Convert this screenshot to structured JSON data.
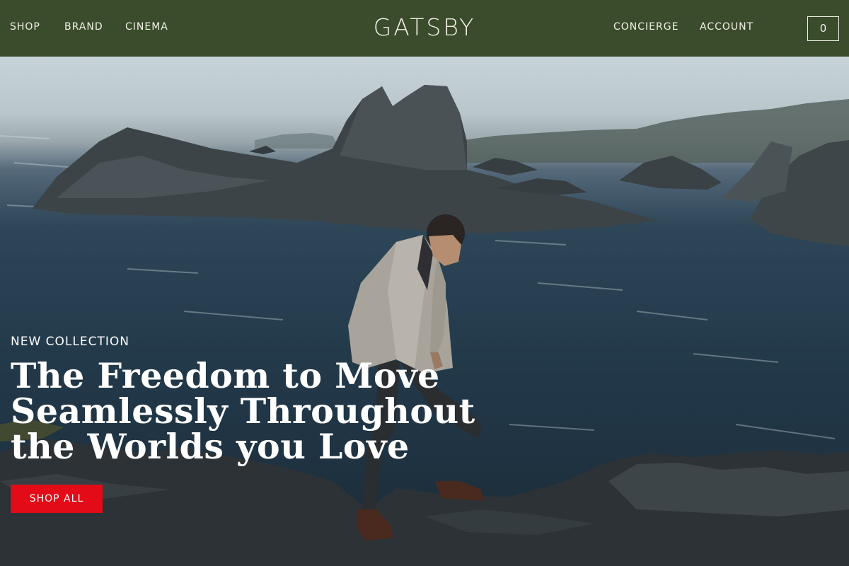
{
  "header": {
    "nav_left": [
      "SHOP",
      "BRAND",
      "CINEMA"
    ],
    "logo": "GATSBY",
    "nav_right": [
      "CONCIERGE",
      "ACCOUNT"
    ],
    "cart_count": "0"
  },
  "hero": {
    "eyebrow": "NEW COLLECTION",
    "headline_lines": [
      "The Freedom to Move",
      "Seamlessly Throughout",
      "the Worlds you Love"
    ],
    "cta_label": "SHOP ALL"
  },
  "colors": {
    "header_bg": "#3a4c2c",
    "header_text": "#f2f0e6",
    "cta_bg": "#e30b17",
    "hero_text": "#ffffff"
  }
}
